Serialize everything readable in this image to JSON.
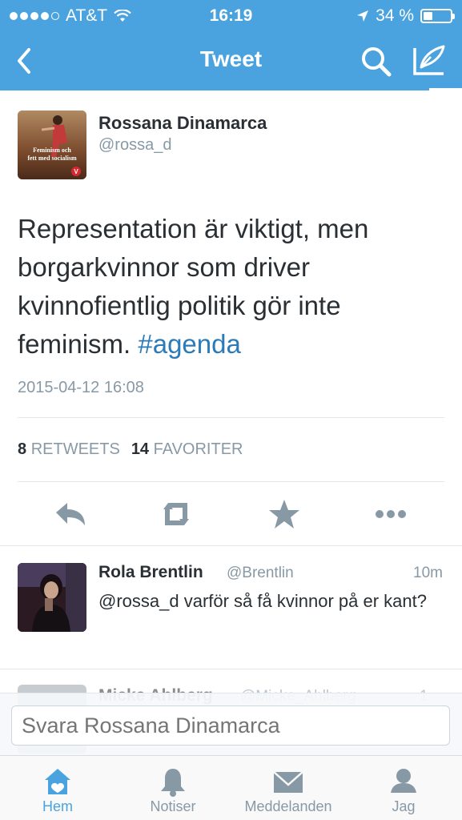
{
  "status_bar": {
    "carrier": "AT&T",
    "time": "16:19",
    "battery": "34 %",
    "battery_level": 0.34
  },
  "nav": {
    "title": "Tweet",
    "icons": [
      "back-chevron-icon",
      "search-icon",
      "compose-icon"
    ]
  },
  "tweet": {
    "author_name": "Rossana Dinamarca",
    "author_handle": "@rossa_d",
    "avatar_overlay_text": "Feminism och\nfett med socialism",
    "text": "Representation är viktigt, men borgarkvinnor som driver kvinnofientlig politik gör inte feminism.",
    "hashtag": "#agenda",
    "timestamp": "2015-04-12 16:08",
    "retweets_count": "8",
    "retweets_label": "RETWEETS",
    "favorites_count": "14",
    "favorites_label": "FAVORITER",
    "actions": [
      "reply-icon",
      "retweet-icon",
      "favorite-star-icon",
      "more-dots-icon"
    ]
  },
  "reply": {
    "name": "Rola Brentlin",
    "handle": "@Brentlin",
    "time": "10m",
    "text": "@rossa_d varför så få kvinnor på er kant?"
  },
  "next_reply": {
    "name": "Micke Ahlberg",
    "handle": "@Micke_Ahlberg",
    "time": "1"
  },
  "composer": {
    "placeholder": "Svara Rossana Dinamarca"
  },
  "tabbar": {
    "tabs": [
      {
        "label": "Hem",
        "icon": "home-icon",
        "active": true
      },
      {
        "label": "Notiser",
        "icon": "bell-icon",
        "active": false
      },
      {
        "label": "Meddelanden",
        "icon": "envelope-icon",
        "active": false
      },
      {
        "label": "Jag",
        "icon": "person-icon",
        "active": false
      }
    ]
  },
  "colors": {
    "brand_blue": "#4aa3df",
    "link_blue": "#2b7bb9",
    "muted_gray": "#8899a6",
    "text_dark": "#292f33"
  }
}
